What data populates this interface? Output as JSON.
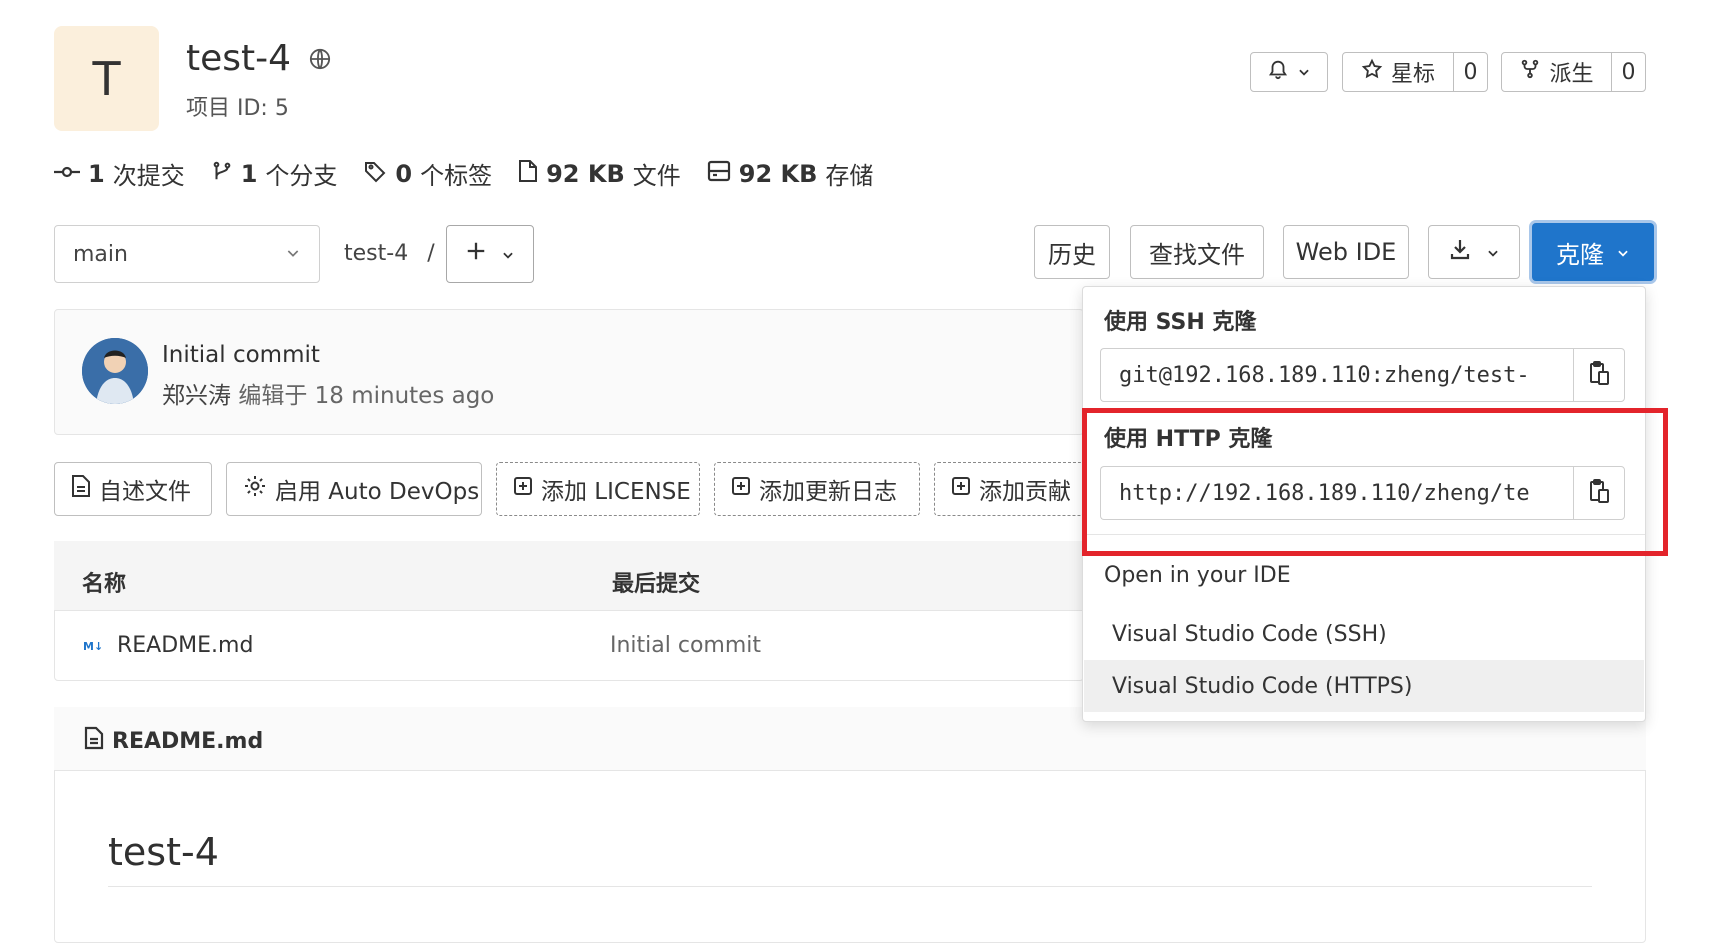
{
  "project": {
    "avatar_letter": "T",
    "name": "test-4",
    "id_text": "项目 ID: 5"
  },
  "header_actions": {
    "star_label": "星标",
    "star_count": "0",
    "fork_label": "派生",
    "fork_count": "0"
  },
  "stats": [
    {
      "num": "1",
      "label": "次提交",
      "icon": "commit-icon"
    },
    {
      "num": "1",
      "label": "个分支",
      "icon": "branch-icon"
    },
    {
      "num": "0",
      "label": "个标签",
      "icon": "tag-icon"
    },
    {
      "num": "92 KB",
      "label": "文件",
      "icon": "file-icon"
    },
    {
      "num": "92 KB",
      "label": "存储",
      "icon": "storage-icon"
    }
  ],
  "toolbar": {
    "branch": "main",
    "breadcrumb_project": "test-4",
    "breadcrumb_sep": "/",
    "history": "历史",
    "find_file": "查找文件",
    "web_ide": "Web IDE",
    "clone": "克隆"
  },
  "last_commit": {
    "title": "Initial commit",
    "author": "郑兴涛",
    "meta": "编辑于 18 minutes ago"
  },
  "action_buttons": [
    {
      "label": "自述文件",
      "icon": "file-icon",
      "dashed": false
    },
    {
      "label": "启用 Auto DevOps",
      "icon": "gear-icon",
      "dashed": false
    },
    {
      "label": "添加 LICENSE",
      "icon": "plus-square-icon",
      "dashed": true
    },
    {
      "label": "添加更新日志",
      "icon": "plus-square-icon",
      "dashed": true
    },
    {
      "label": "添加贡献",
      "icon": "plus-square-icon",
      "dashed": true
    }
  ],
  "file_table": {
    "col_name": "名称",
    "col_last_commit": "最后提交",
    "rows": [
      {
        "name": "README.md",
        "commit": "Initial commit",
        "icon": "markdown-icon"
      }
    ]
  },
  "readme": {
    "filename": "README.md",
    "heading": "test-4"
  },
  "clone_dropdown": {
    "ssh_label": "使用 SSH 克隆",
    "ssh_url": "git@192.168.189.110:zheng/test-",
    "http_label": "使用 HTTP 克隆",
    "http_url": "http://192.168.189.110/zheng/te",
    "ide_label": "Open in your IDE",
    "ide_options": [
      "Visual Studio Code (SSH)",
      "Visual Studio Code (HTTPS)"
    ]
  },
  "colors": {
    "primary": "#1f75cb",
    "highlight": "#e3242b",
    "avatar_bg": "#fbefdc"
  }
}
